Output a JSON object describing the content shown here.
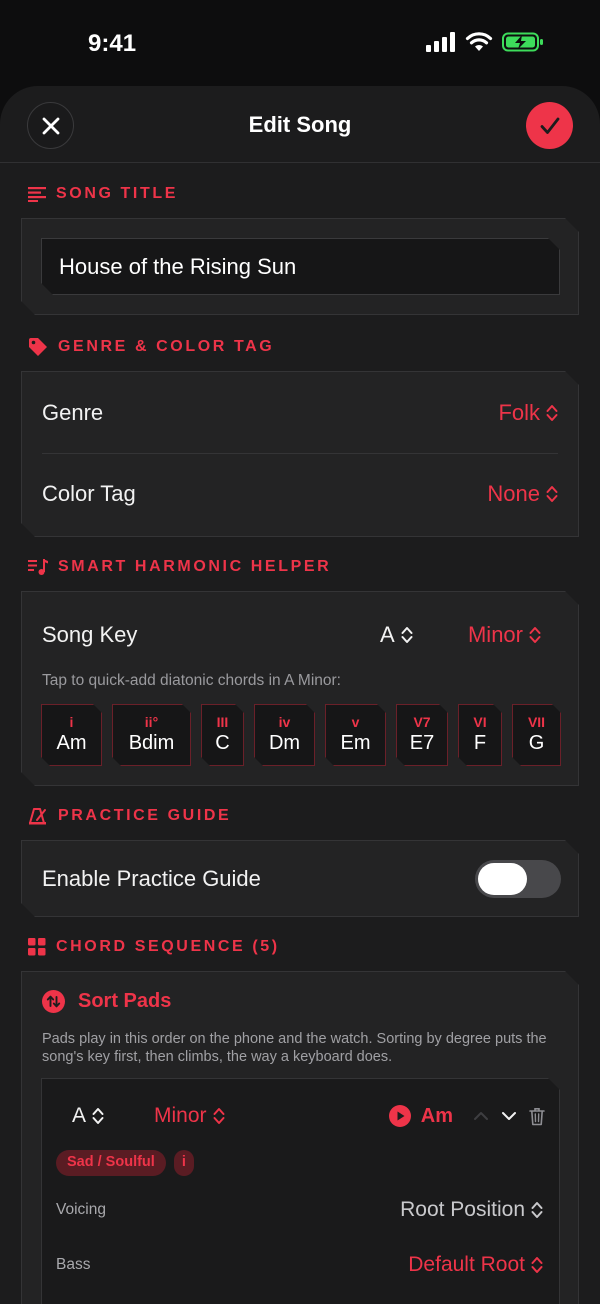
{
  "status": {
    "time": "9:41"
  },
  "nav": {
    "title": "Edit Song"
  },
  "sections": {
    "song_title": "SONG TITLE",
    "genre_color": "GENRE & COLOR TAG",
    "harmonic": "SMART HARMONIC HELPER",
    "practice": "PRACTICE GUIDE",
    "sequence": "CHORD SEQUENCE (5)"
  },
  "song": {
    "title": "House of the Rising Sun"
  },
  "genre": {
    "label": "Genre",
    "value": "Folk"
  },
  "color_tag": {
    "label": "Color Tag",
    "value": "None"
  },
  "song_key": {
    "label": "Song Key",
    "root": "A",
    "mode": "Minor"
  },
  "harmonic_hint": "Tap to quick-add diatonic chords in A Minor:",
  "diatonic_chords": [
    {
      "degree": "i",
      "name": "Am"
    },
    {
      "degree": "ii°",
      "name": "Bdim"
    },
    {
      "degree": "III",
      "name": "C"
    },
    {
      "degree": "iv",
      "name": "Dm"
    },
    {
      "degree": "v",
      "name": "Em"
    },
    {
      "degree": "V7",
      "name": "E7"
    },
    {
      "degree": "VI",
      "name": "F"
    },
    {
      "degree": "VII",
      "name": "G"
    }
  ],
  "practice_guide": {
    "label": "Enable Practice Guide",
    "enabled": false
  },
  "sort": {
    "label": "Sort Pads",
    "description": "Pads play in this order on the phone and the watch. Sorting by degree puts the song's key first, then climbs, the way a keyboard does."
  },
  "pad": {
    "root": "A",
    "mode": "Minor",
    "chord": "Am",
    "mood_tag": "Sad / Soulful",
    "info_tag": "i",
    "voicing_label": "Voicing",
    "voicing_value": "Root Position",
    "bass_label": "Bass",
    "bass_value": "Default Root"
  },
  "colors": {
    "accent": "#ee3449",
    "background": "#1c1c1d",
    "card": "#232324",
    "battery": "#3ddc5b"
  }
}
